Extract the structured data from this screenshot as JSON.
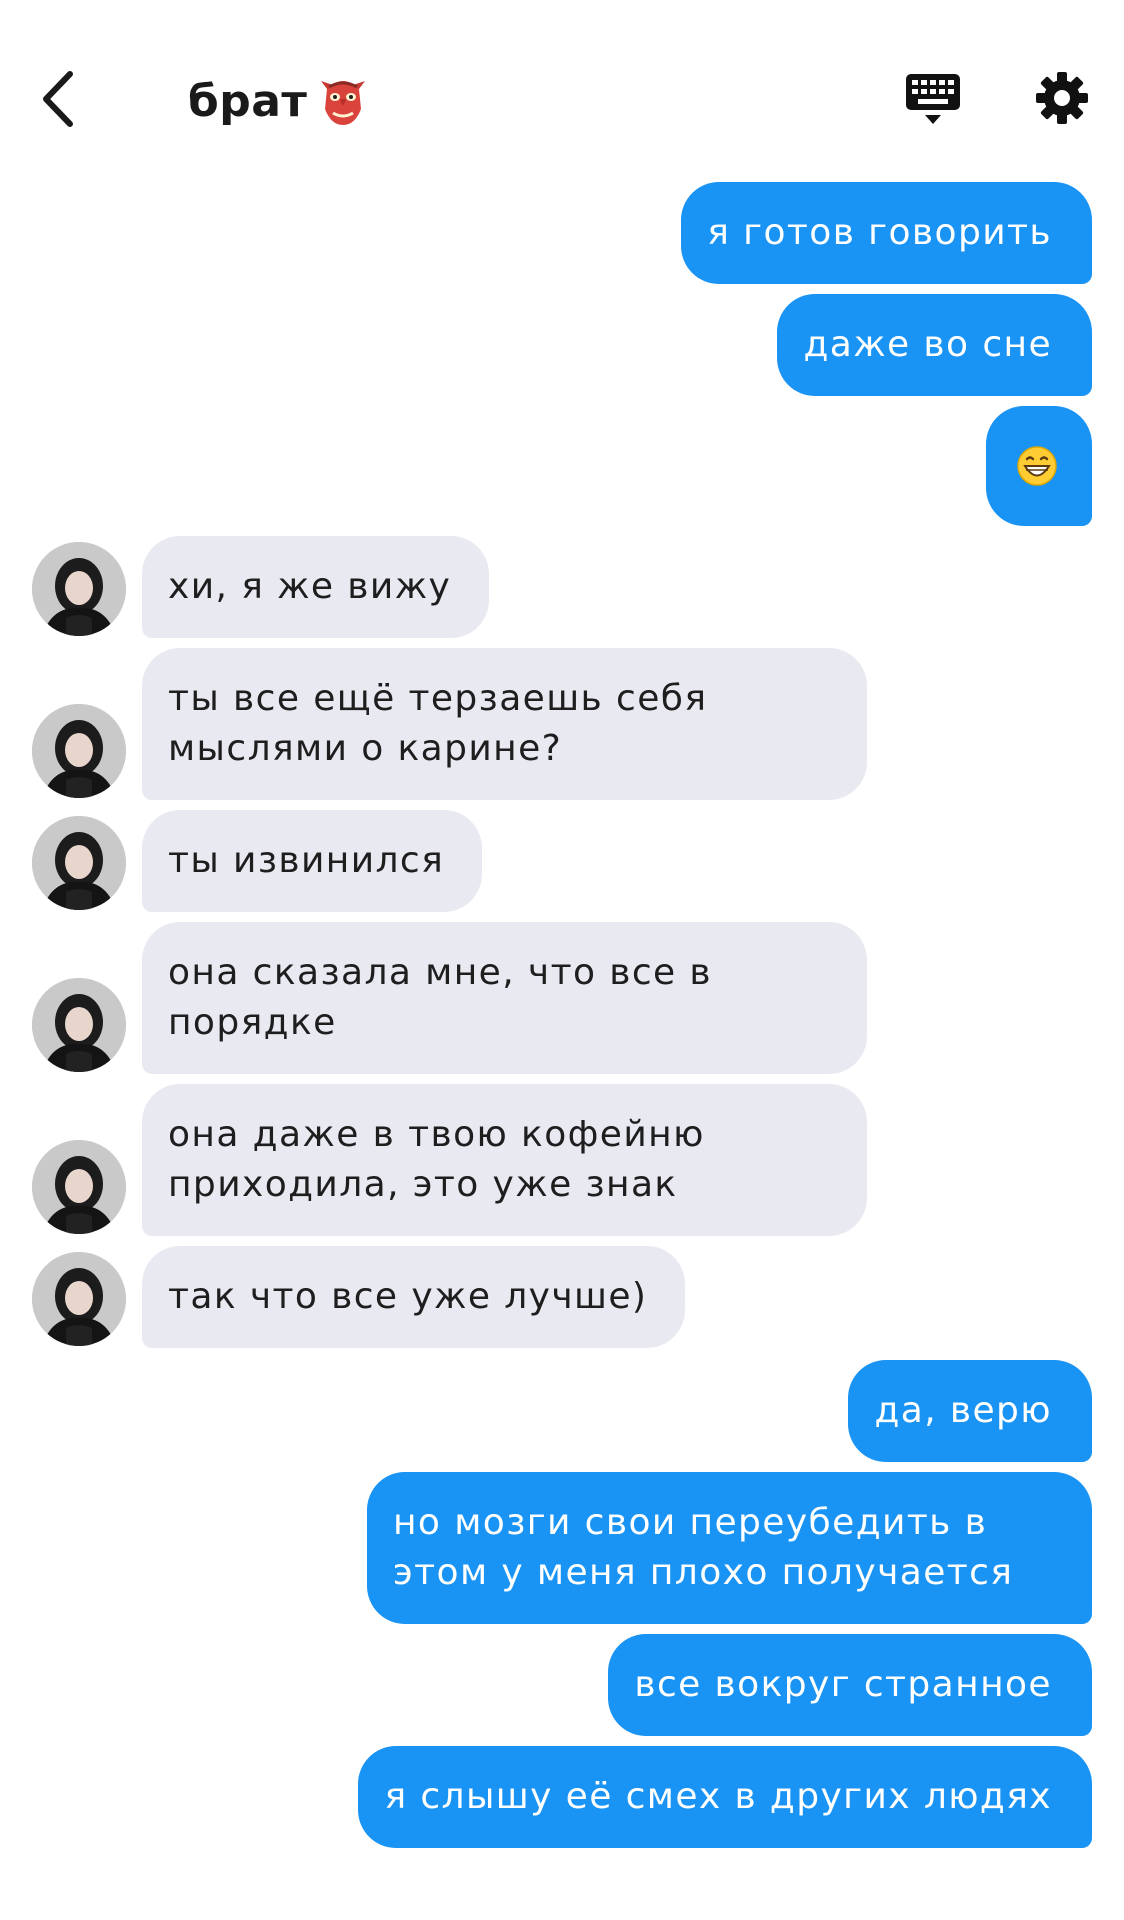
{
  "header": {
    "title": "брат",
    "title_emoji": "goblin-mask-icon"
  },
  "icons": {
    "back": "chevron-left-icon",
    "keyboard": "keyboard-icon",
    "settings": "gear-icon"
  },
  "colors": {
    "outgoing_bubble": "#1993f4",
    "incoming_bubble": "#e9eaf1",
    "outgoing_text": "#ffffff",
    "incoming_text": "#1e1e1e"
  },
  "messages": [
    {
      "direction": "out",
      "text": "я готов говорить"
    },
    {
      "direction": "out",
      "text": "даже во сне"
    },
    {
      "direction": "out",
      "text": "",
      "emoji": "grinning-face-icon"
    },
    {
      "direction": "in",
      "text": "хи, я же вижу"
    },
    {
      "direction": "in",
      "text": "ты все ещё терзаешь себя мыслями о карине?"
    },
    {
      "direction": "in",
      "text": "ты извинился"
    },
    {
      "direction": "in",
      "text": "она сказала мне, что все в порядке"
    },
    {
      "direction": "in",
      "text": "она даже в твою кофейню приходила, это уже знак"
    },
    {
      "direction": "in",
      "text": "так что все уже лучше)"
    },
    {
      "direction": "out",
      "text": "да, верю"
    },
    {
      "direction": "out",
      "text": "но мозги свои переубедить в этом у меня плохо получается"
    },
    {
      "direction": "out",
      "text": "все вокруг странное"
    },
    {
      "direction": "out",
      "text": "я слышу её смех в других людях"
    }
  ]
}
